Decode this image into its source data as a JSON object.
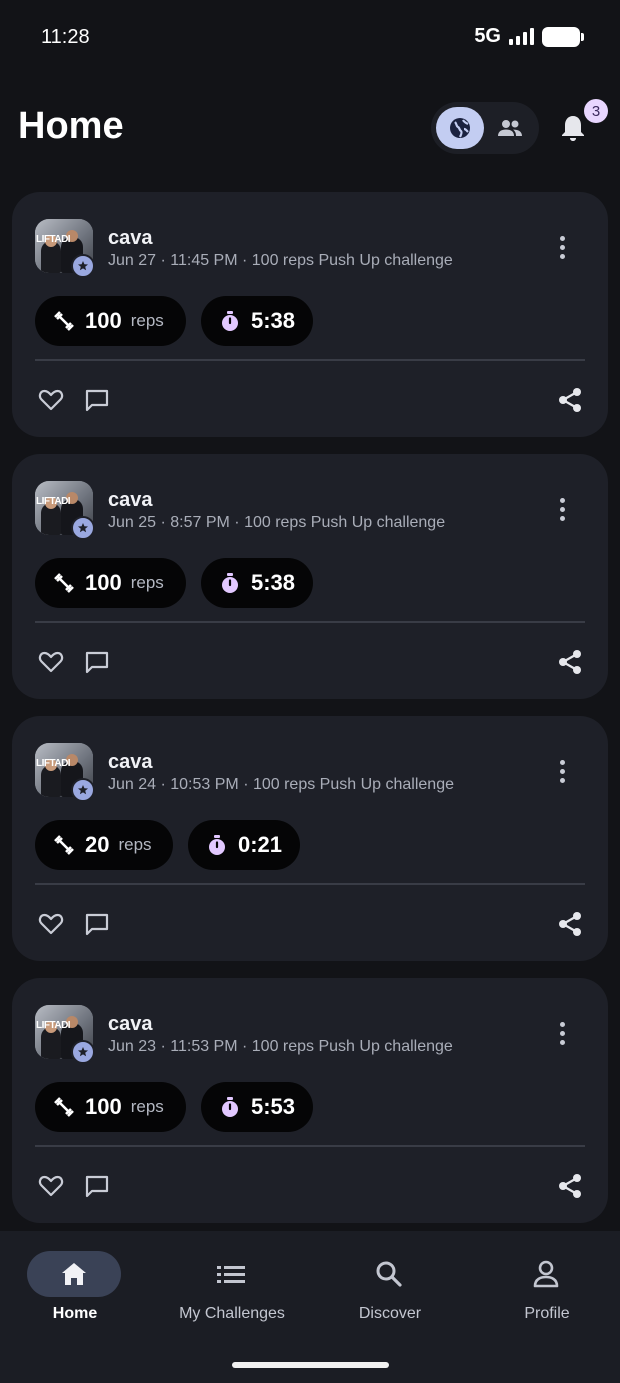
{
  "status_bar": {
    "time": "11:28",
    "network": "5G"
  },
  "header": {
    "title": "Home",
    "notifications_count": "3"
  },
  "feed_toggle": {
    "active": "globe",
    "options": [
      "globe-icon",
      "people-icon"
    ]
  },
  "posts": [
    {
      "user": "cava",
      "meta": "Jun 27 · 11:45 PM · 100 reps Push Up challenge",
      "reps": "100",
      "reps_unit": "reps",
      "time": "5:38"
    },
    {
      "user": "cava",
      "meta": "Jun 25 · 8:57 PM · 100 reps Push Up challenge",
      "reps": "100",
      "reps_unit": "reps",
      "time": "5:38"
    },
    {
      "user": "cava",
      "meta": "Jun 24 · 10:53 PM · 100 reps Push Up challenge",
      "reps": "20",
      "reps_unit": "reps",
      "time": "0:21"
    },
    {
      "user": "cava",
      "meta": "Jun 23 · 11:53 PM · 100 reps Push Up challenge",
      "reps": "100",
      "reps_unit": "reps",
      "time": "5:53"
    }
  ],
  "avatar_logo_text": "LIFTADI",
  "bottom_nav": {
    "items": [
      {
        "label": "Home",
        "icon": "home-icon",
        "active": true
      },
      {
        "label": "My Challenges",
        "icon": "list-icon",
        "active": false
      },
      {
        "label": "Discover",
        "icon": "search-icon",
        "active": false
      },
      {
        "label": "Profile",
        "icon": "person-icon",
        "active": false
      }
    ]
  },
  "colors": {
    "background": "#121317",
    "card": "#1e2028",
    "accent": "#c3cdf2",
    "timer": "#e2c8ff"
  }
}
